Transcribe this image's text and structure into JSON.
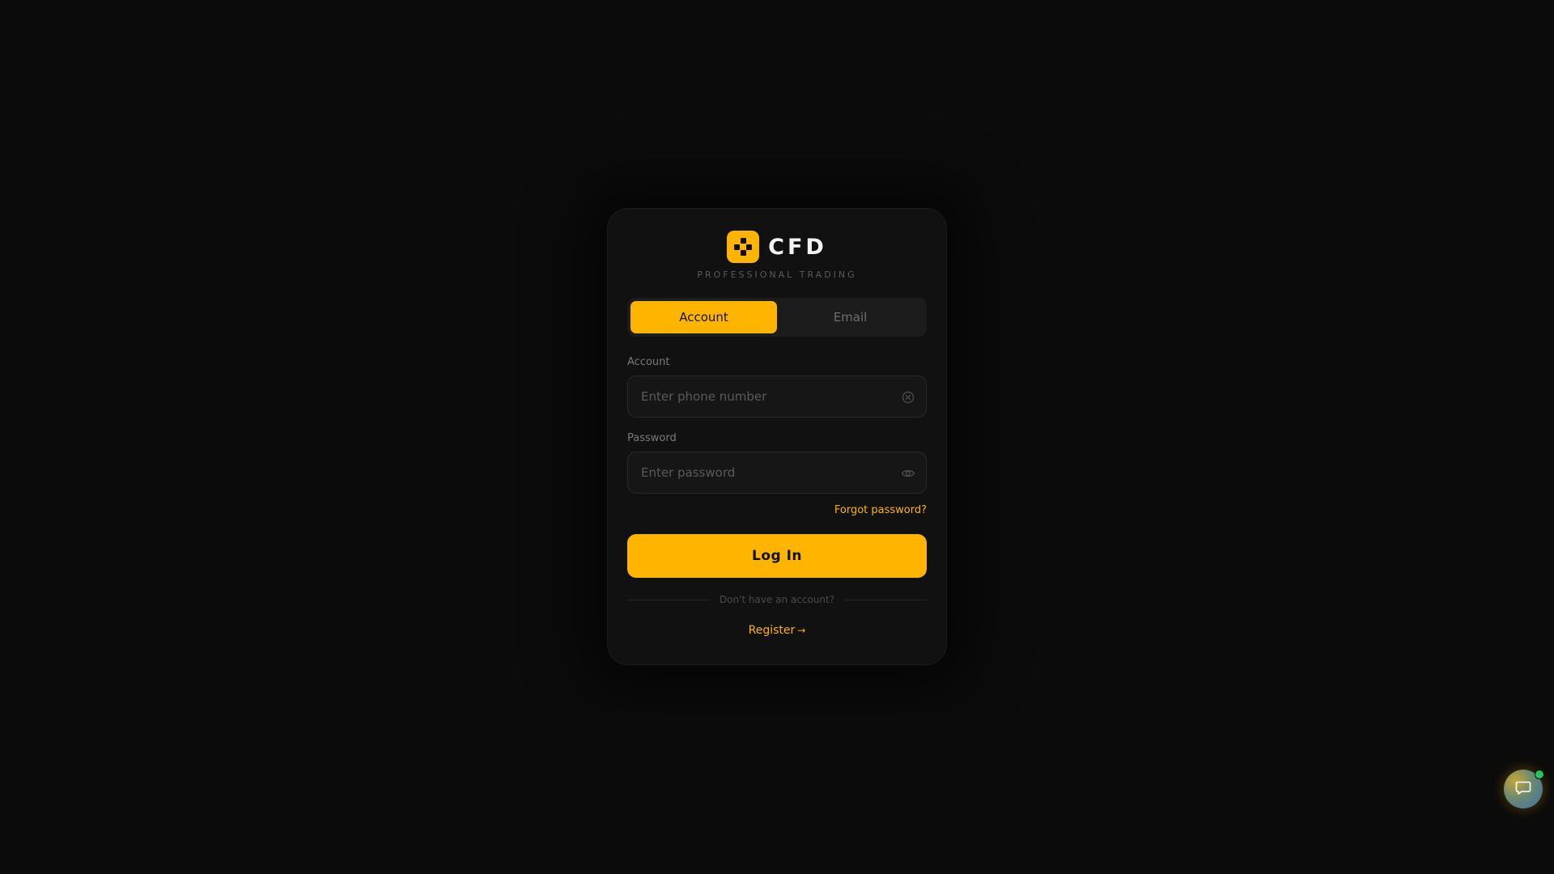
{
  "brand": {
    "name": "CFD",
    "tagline": "PROFESSIONAL TRADING"
  },
  "tabs": [
    {
      "label": "Account",
      "active": true
    },
    {
      "label": "Email",
      "active": false
    }
  ],
  "form": {
    "account_label": "Account",
    "account_placeholder": "Enter phone number",
    "account_value": "",
    "password_label": "Password",
    "password_placeholder": "Enter password",
    "password_value": "",
    "forgot_label": "Forgot password?",
    "login_label": "Log In",
    "no_account_text": "Don't have an account?",
    "register_label": "Register",
    "register_arrow": "→"
  },
  "icons": {
    "logo": "logo-mark-icon",
    "account_clear": "clear-circle-icon",
    "password_toggle": "eye-icon",
    "chat": "chat-bubble-icon"
  },
  "colors": {
    "accent": "#ffb400",
    "background": "#0b0b0b",
    "card": "#111111",
    "online_indicator": "#22c55e"
  }
}
